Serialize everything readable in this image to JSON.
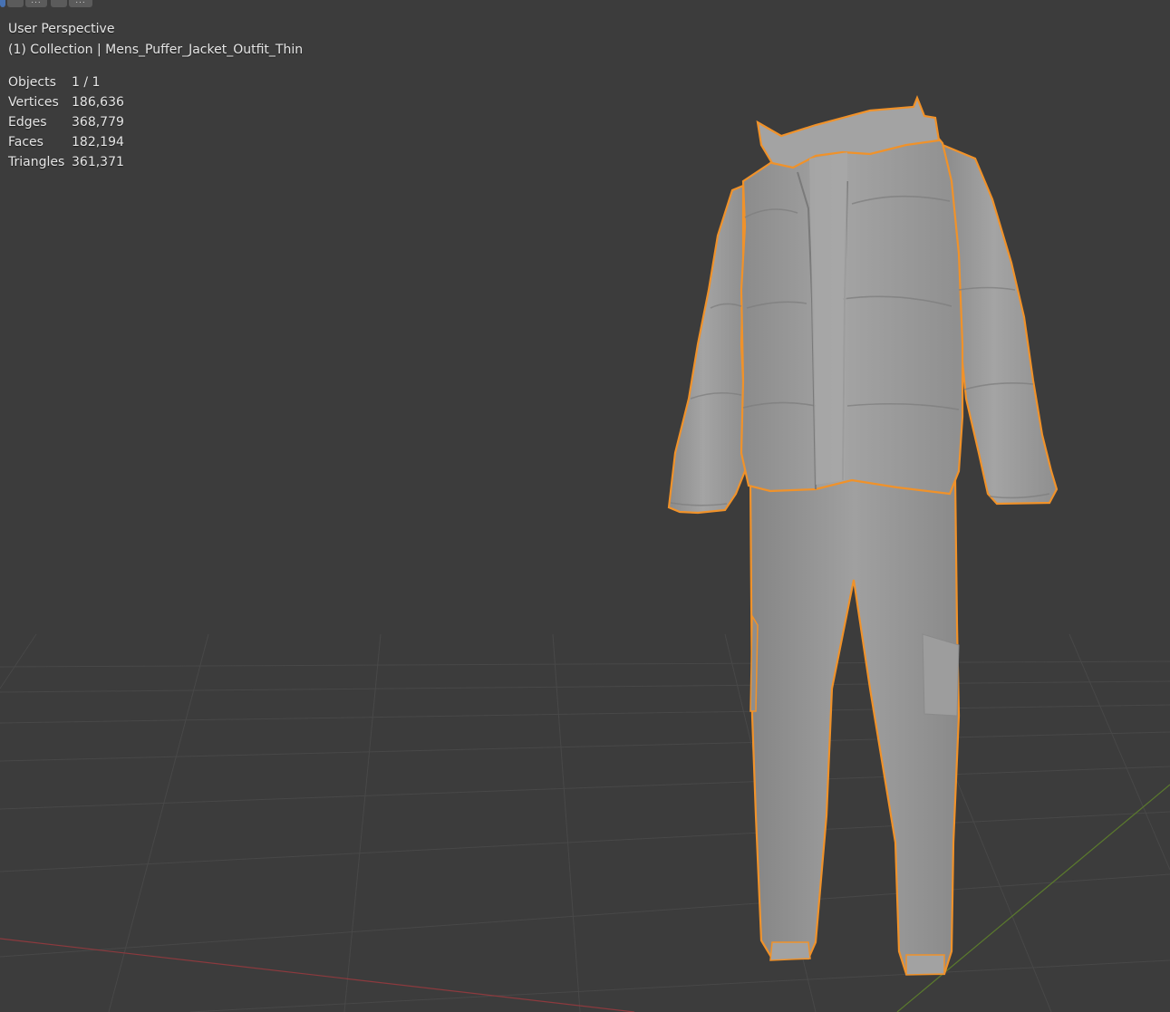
{
  "viewport": {
    "view_name": "User Perspective",
    "collection_line": "(1) Collection | Mens_Puffer_Jacket_Outfit_Thin",
    "stats": [
      {
        "label": "Objects",
        "value": "1 / 1"
      },
      {
        "label": "Vertices",
        "value": "186,636"
      },
      {
        "label": "Edges",
        "value": "368,779"
      },
      {
        "label": "Faces",
        "value": "182,194"
      },
      {
        "label": "Triangles",
        "value": "361,371"
      }
    ]
  },
  "header_widgets": {
    "overflow_glyph": "..."
  },
  "colors": {
    "background": "#3c3c3c",
    "grid": "#4a4a4a",
    "x_axis": "#8c3a3e",
    "y_axis": "#5b7a2d",
    "selection_outline": "#f0922a",
    "mesh": "#9a9a9a",
    "header_active": "#4772b3"
  },
  "icons": {
    "header_mode_icon": "selection-mode-icon"
  }
}
